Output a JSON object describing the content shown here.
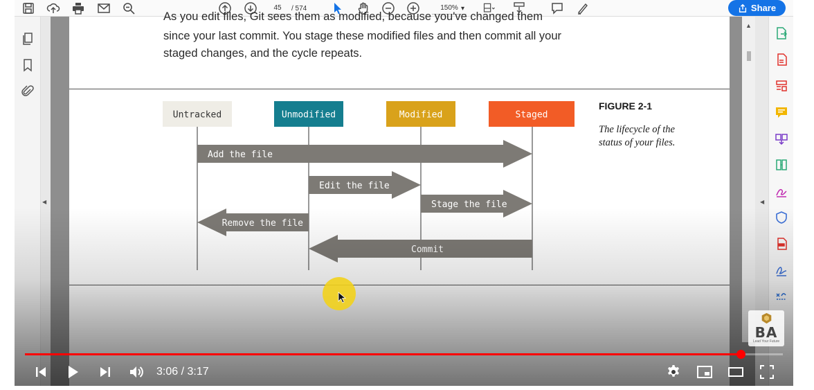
{
  "toolbar": {
    "page_current": "45",
    "page_total": "/ 574",
    "zoom": "150%",
    "share_label": "Share"
  },
  "document": {
    "line_cut": "As you edit files, Git sees them as modified, because you've changed them",
    "line_1": "since your last commit. You stage these modified files and then commit all your",
    "line_2": "staged changes, and the cycle repeats.",
    "figure_title": "FIGURE 2-1",
    "figure_caption": "The lifecycle of the status of your files."
  },
  "diagram": {
    "states": [
      {
        "label": "Untracked",
        "fill": "#efede6",
        "text_color": "#333333"
      },
      {
        "label": "Unmodified",
        "fill": "#157e8f",
        "text_color": "#ffffff"
      },
      {
        "label": "Modified",
        "fill": "#d9a21b",
        "text_color": "#ffffff"
      },
      {
        "label": "Staged",
        "fill": "#f25c26",
        "text_color": "#ffffff"
      }
    ],
    "arrows": [
      {
        "label": "Add the file",
        "from": "Untracked",
        "to": "Staged"
      },
      {
        "label": "Edit the file",
        "from": "Unmodified",
        "to": "Modified"
      },
      {
        "label": "Stage the file",
        "from": "Modified",
        "to": "Staged"
      },
      {
        "label": "Remove the file",
        "from": "Unmodified",
        "to": "Untracked"
      },
      {
        "label": "Commit",
        "from": "Staged",
        "to": "Unmodified"
      }
    ],
    "arrow_color": "#7d7a75"
  },
  "player": {
    "time_current": "3:06",
    "time_total": "3:17",
    "time_display": "3:06 / 3:17",
    "progress": 0.944,
    "progress_color": "#ff0000"
  },
  "branding": {
    "mark": "BA",
    "tagline": "Lead Your Future"
  },
  "colors": {
    "share_button": "#1473e6",
    "cursor_highlight": "#f2d21c"
  }
}
